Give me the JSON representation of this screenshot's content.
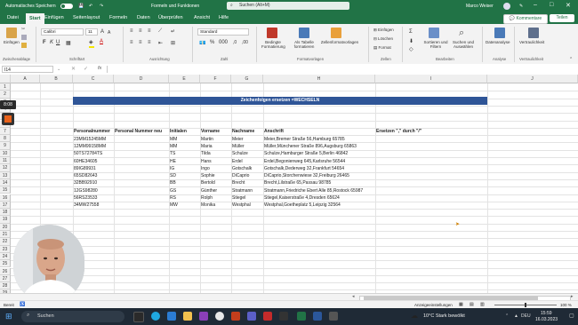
{
  "titlebar": {
    "autosave_label": "Automatisches Speichern",
    "doc_title": "Formeln und Funktionen",
    "search_placeholder": "Suchen (Alt+M)",
    "user": "Marco Weiser",
    "window_controls": [
      "–",
      "□",
      "✕"
    ]
  },
  "menu": {
    "tabs": [
      "Datei",
      "Start",
      "Einfügen",
      "Seitenlayout",
      "Formeln",
      "Daten",
      "Überprüfen",
      "Ansicht",
      "Hilfe"
    ],
    "active_tab": "Start",
    "comments_label": "Kommentare",
    "share_label": "Teilen"
  },
  "ribbon": {
    "paste_label": "Einfügen",
    "clipboard_group": "Zwischenablage",
    "font_name": "Calibri",
    "font_size": "11",
    "font_group": "Schriftart",
    "align_group": "Ausrichtung",
    "number_format": "Standard",
    "number_group": "Zahl",
    "cond_format_label": "Bedingte Formatierung",
    "as_table_label": "Als Tabelle formatieren",
    "cell_styles_label": "Zellenformatvorlagen",
    "styles_group": "Formatvorlagen",
    "insert_label": "Einfügen",
    "delete_label": "Löschen",
    "format_label": "Format",
    "cells_group": "Zellen",
    "sort_filter_label": "Sortieren und Filtern",
    "find_select_label": "Suchen und Auswählen",
    "edit_group": "Bearbeiten",
    "data_analysis_label": "Datenanalyse",
    "analysis_group": "Analyse",
    "sensitivity_label": "Vertraulichkeit",
    "sensitivity_group": "Vertraulichkeit"
  },
  "formula_bar": {
    "name_box": "I14",
    "fx": "fx",
    "content": ""
  },
  "grid": {
    "columns": [
      "A",
      "B",
      "C",
      "D",
      "E",
      "F",
      "G",
      "H",
      "I",
      "J"
    ],
    "rows": [
      "1",
      "2",
      "3",
      "4",
      "5",
      "6",
      "7",
      "8",
      "9",
      "10",
      "11",
      "12",
      "13",
      "14",
      "15",
      "16",
      "17",
      "18",
      "19",
      "20",
      "21",
      "22",
      "23",
      "24",
      "25",
      "26",
      "27",
      "28",
      "29"
    ],
    "banner": "Zeichenfolgen ersetzen =WECHSELN",
    "headers": [
      "Personalnummer",
      "Personal Nummer neu",
      "Initialen",
      "Vorname",
      "Nachname",
      "Anschrift",
      "Ersetzen \",\" durch \"/\""
    ],
    "data": [
      [
        "23MM15245MM",
        "MM",
        "Martin",
        "Meier",
        "Meier,Bremer Straße 56,Hamburg 65785"
      ],
      [
        "12MM99158MM",
        "MM",
        "Maria",
        "Müller",
        "Müller,Münchener Straße 896,Augsburg 65863"
      ],
      [
        "50TS72784TS",
        "TS",
        "Tilda",
        "Schulze",
        "Schulze,Hamburger Straße 5,Berlin 46842"
      ],
      [
        "60HE34605",
        "HE",
        "Hans",
        "Erdel",
        "Erdel,Begonienweg 645,Karlsruhe 56544"
      ],
      [
        "89IG89931",
        "IG",
        "Ingo",
        "Gotschalk",
        "Gotschalk,Dederweg 32,Frankfurt 54654"
      ],
      [
        "65SD82643",
        "SD",
        "Sophie",
        "DiCaprio",
        "DiCaprio,Storchenwiese 32,Freiburg 26465"
      ],
      [
        "32BB92910",
        "BB",
        "Bertold",
        "Brecht",
        "Brecht,Lilstraße 65,Passau 98785"
      ],
      [
        "12GS98280",
        "GS",
        "Günther",
        "Stratmann",
        "Stratmann,Friedriche Ebert Alle 85,Rostock 65987"
      ],
      [
        "56RS23533",
        "RS",
        "Rolph",
        "Stiegel",
        "Stiegel,Kaiserstraße 4,Dresden 65624"
      ],
      [
        "34MW27558",
        "MW",
        "Monika",
        "Westphal",
        "Westphal,Goetheplatz 5,Leipzig 32564"
      ]
    ]
  },
  "recording": {
    "timer": "8:08"
  },
  "statusbar": {
    "ready": "Bereit",
    "display_settings": "Anzeigeeinstellungen",
    "zoom": "100 %"
  },
  "taskbar": {
    "search_label": "Suchen",
    "weather": "10°C  Stark bewölkt",
    "lang": "DEU",
    "time": "15:59",
    "date": "16.03.2023"
  },
  "colors": {
    "excel_green": "#217346",
    "banner_blue": "#2f5597"
  }
}
